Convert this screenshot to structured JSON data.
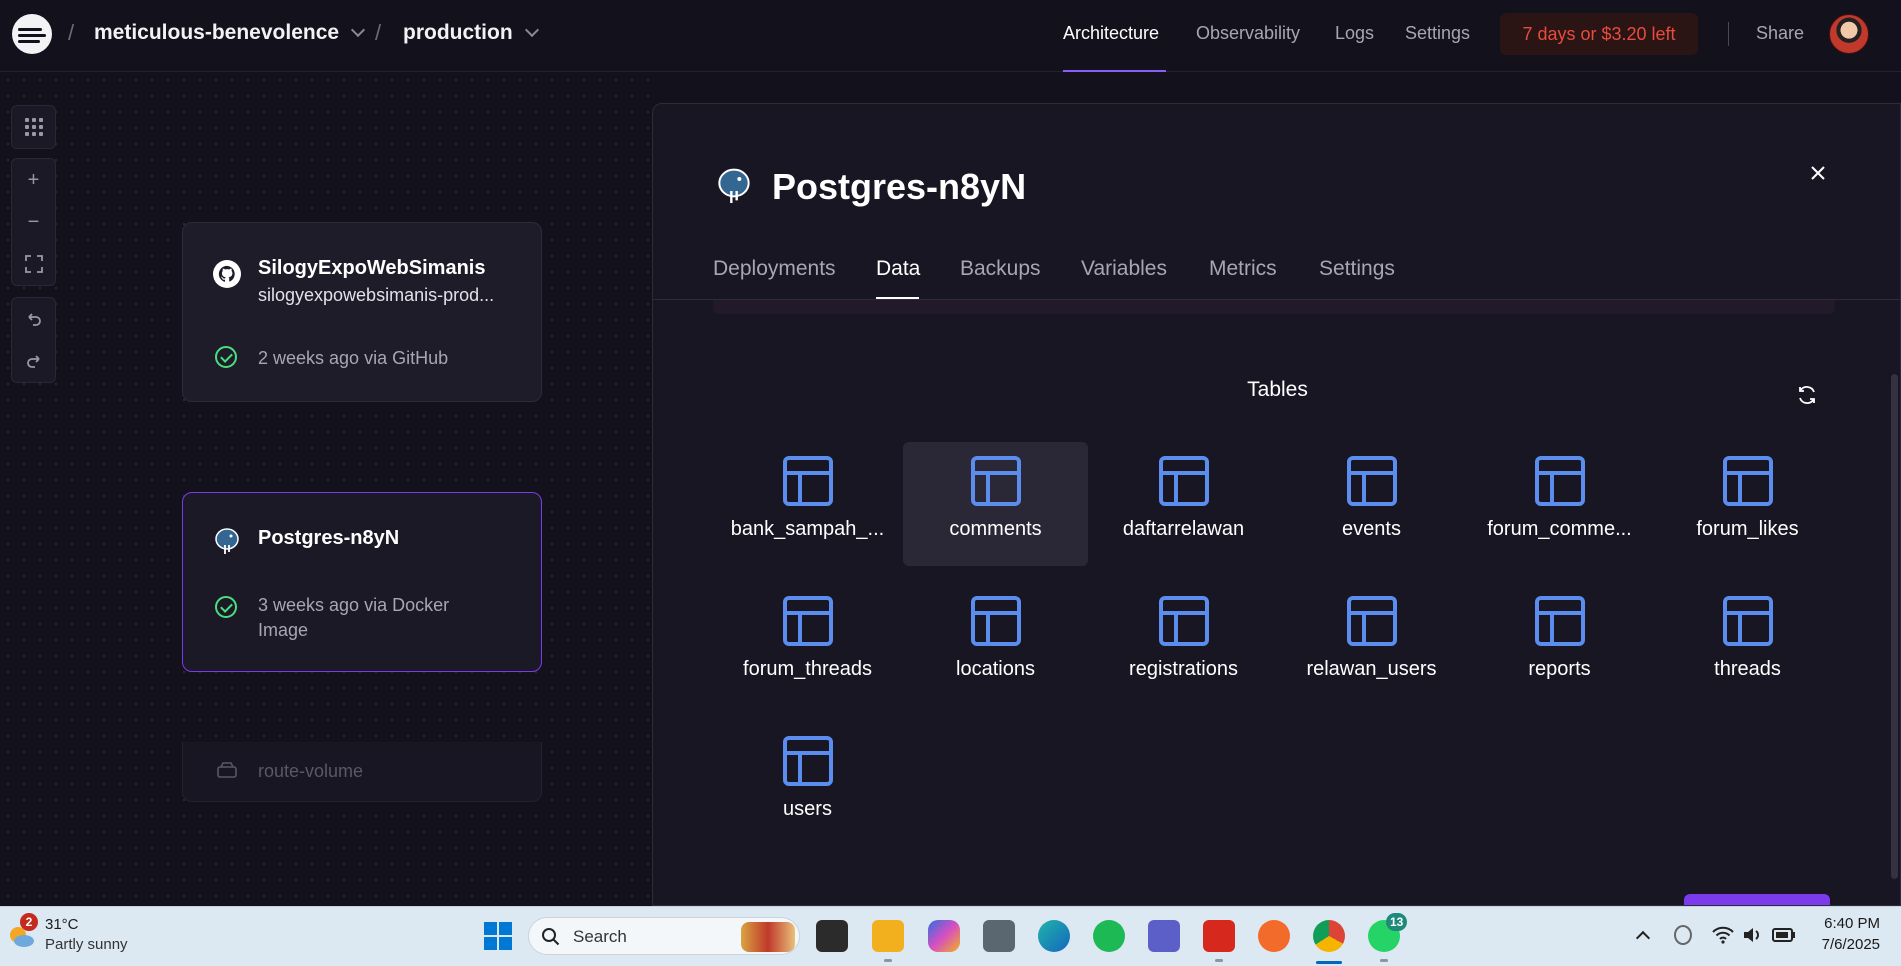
{
  "header": {
    "project": "meticulous-benevolence",
    "environment": "production",
    "nav": [
      "Architecture",
      "Observability",
      "Logs",
      "Settings"
    ],
    "trial": "7 days or $3.20 left",
    "share": "Share",
    "separator": "/"
  },
  "canvas": {
    "service_card": {
      "title": "SilogyExpoWebSimanis",
      "subtitle": "silogyexpowebsimanis-prod...",
      "status": "2 weeks ago via GitHub"
    },
    "db_card": {
      "title": "Postgres-n8yN",
      "status": "3 weeks ago via Docker Image",
      "volume": "route-volume"
    }
  },
  "panel": {
    "title": "Postgres-n8yN",
    "tabs": [
      "Deployments",
      "Data",
      "Backups",
      "Variables",
      "Metrics",
      "Settings"
    ],
    "active_tab": "Data",
    "tables_heading": "Tables",
    "tables": [
      "bank_sampah_...",
      "comments",
      "daftarrelawan",
      "events",
      "forum_comme...",
      "forum_likes",
      "forum_threads",
      "locations",
      "registrations",
      "relawan_users",
      "reports",
      "threads",
      "users"
    ]
  },
  "taskbar": {
    "weather_temp": "31°C",
    "weather_desc": "Partly sunny",
    "weather_badge": "2",
    "search_placeholder": "Search",
    "whatsapp_badge": "13",
    "time": "6:40 PM",
    "date": "7/6/2025"
  },
  "colors": {
    "accent": "#8b5cf6",
    "table_icon": "#5b8def",
    "success": "#4ade80",
    "warning": "#e74c3c"
  }
}
